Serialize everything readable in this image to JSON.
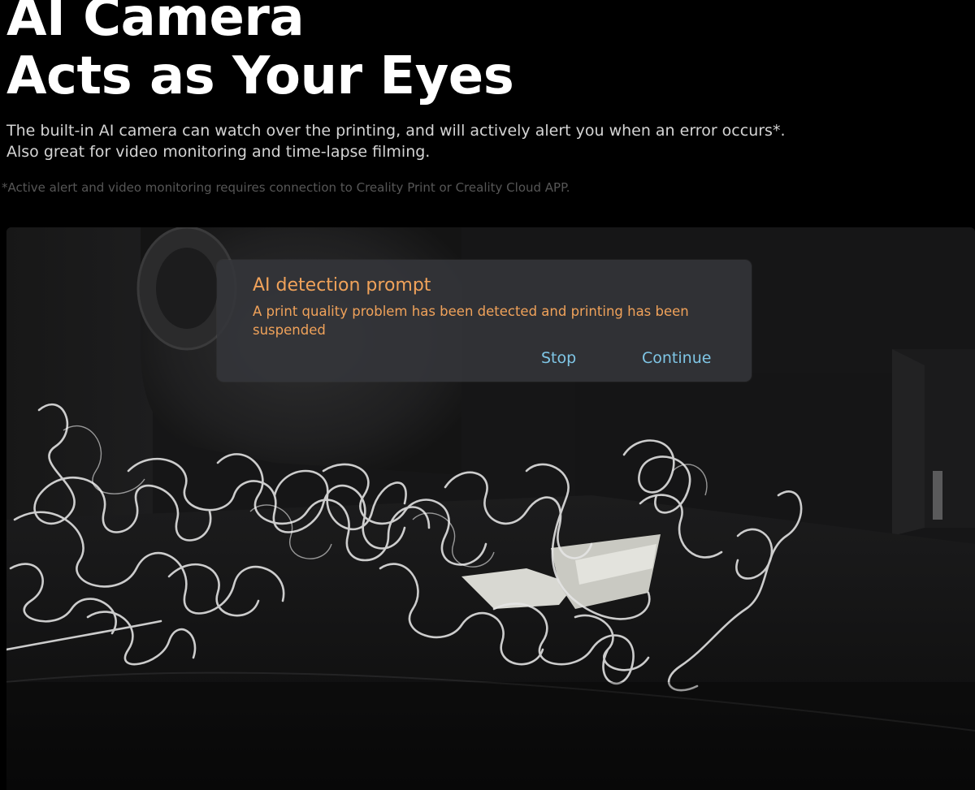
{
  "hero": {
    "headline_line1": "AI Camera",
    "headline_line2": "Acts as Your Eyes",
    "description_line1": "The built-in AI camera can watch over the printing, and will actively alert you when an error occurs*.",
    "description_line2": "Also great for video monitoring and time-lapse filming.",
    "footnote": "*Active alert and video monitoring requires connection to Creality Print or Creality Cloud APP."
  },
  "dialog": {
    "title": "AI detection prompt",
    "message": "A print quality problem has been detected and printing has been suspended",
    "stop_label": "Stop",
    "continue_label": "Continue"
  },
  "colors": {
    "background": "#000000",
    "dialog_text": "#f0a25a",
    "button_text": "#7fc6e6",
    "dialog_bg": "#34363a"
  }
}
